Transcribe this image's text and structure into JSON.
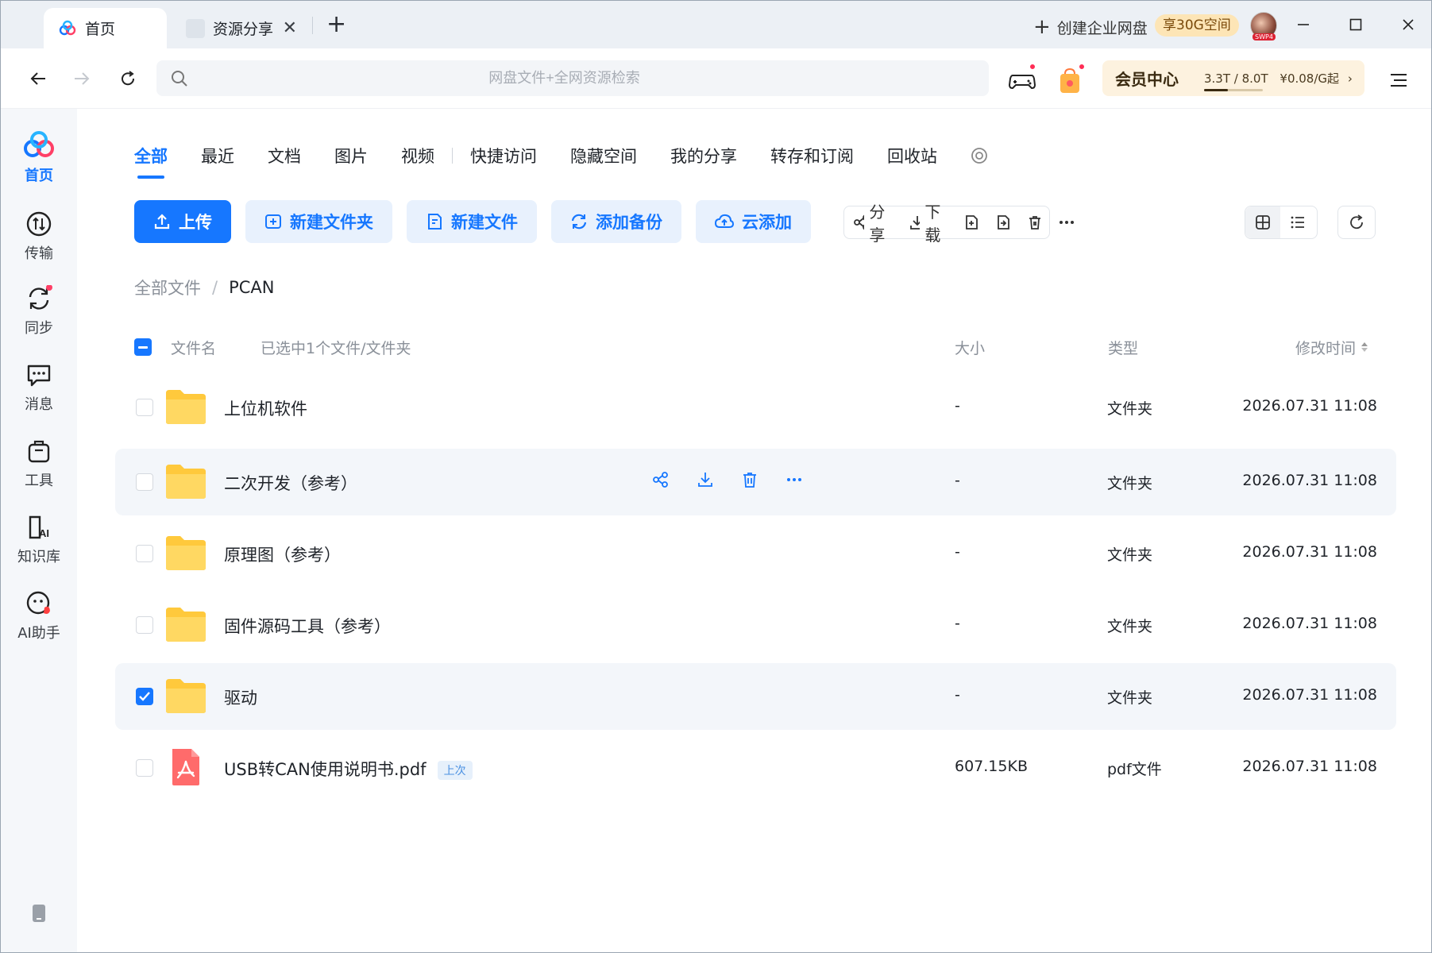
{
  "tabs": [
    {
      "label": "首页",
      "active": true
    },
    {
      "label": "资源分享",
      "active": false
    }
  ],
  "titlebar": {
    "create_enterprise": "创建企业网盘",
    "promo": "享30G空间",
    "avatar_badge": "SWP4"
  },
  "search": {
    "placeholder": "网盘文件+全网资源检索"
  },
  "member": {
    "title": "会员中心",
    "storage": "3.3T / 8.0T",
    "price": "¥0.08/G起",
    "used_fraction": 0.41
  },
  "sidebar": {
    "items": [
      {
        "label": "首页",
        "icon": "home-cloud-icon"
      },
      {
        "label": "传输",
        "icon": "transfer-icon"
      },
      {
        "label": "同步",
        "icon": "sync-icon"
      },
      {
        "label": "消息",
        "icon": "message-icon"
      },
      {
        "label": "工具",
        "icon": "toolbox-icon"
      },
      {
        "label": "知识库",
        "icon": "knowledge-icon"
      },
      {
        "label": "AI助手",
        "icon": "ai-assistant-icon"
      }
    ]
  },
  "categories": [
    "全部",
    "最近",
    "文档",
    "图片",
    "视频",
    "快捷访问",
    "隐藏空间",
    "我的分享",
    "转存和订阅",
    "回收站"
  ],
  "actions": {
    "upload": "上传",
    "new_folder": "新建文件夹",
    "new_file": "新建文件",
    "add_backup": "添加备份",
    "cloud_add": "云添加"
  },
  "toolbar": {
    "share": "分享",
    "download": "下载"
  },
  "breadcrumb": {
    "root": "全部文件",
    "separator": "/",
    "current": "PCAN"
  },
  "table": {
    "header_name": "文件名",
    "selection_text": "已选中1个文件/文件夹",
    "header_size": "大小",
    "header_type": "类型",
    "header_time": "修改时间"
  },
  "files": [
    {
      "name": "上位机软件",
      "size": "-",
      "type": "文件夹",
      "time": "2026.07.31 11:08",
      "kind": "folder",
      "checked": false
    },
    {
      "name": "二次开发（参考）",
      "size": "-",
      "type": "文件夹",
      "time": "2026.07.31 11:08",
      "kind": "folder",
      "checked": false
    },
    {
      "name": "原理图（参考）",
      "size": "-",
      "type": "文件夹",
      "time": "2026.07.31 11:08",
      "kind": "folder",
      "checked": false
    },
    {
      "name": "固件源码工具（参考）",
      "size": "-",
      "type": "文件夹",
      "time": "2026.07.31 11:08",
      "kind": "folder",
      "checked": false
    },
    {
      "name": "驱动",
      "size": "-",
      "type": "文件夹",
      "time": "2026.07.31 11:08",
      "kind": "folder",
      "checked": true
    },
    {
      "name": "USB转CAN使用说明书.pdf",
      "badge": "上次",
      "size": "607.15KB",
      "type": "pdf文件",
      "time": "2026.07.31 11:08",
      "kind": "pdf",
      "checked": false
    }
  ],
  "colors": {
    "accent": "#1677ff",
    "folder": "#ffc93c",
    "pdf": "#ff6b6b",
    "member_bg": "#fdf2df"
  }
}
